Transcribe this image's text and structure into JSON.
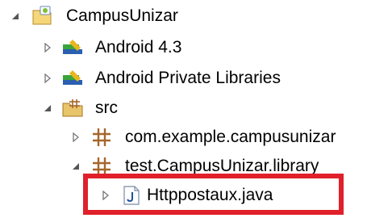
{
  "tree": {
    "project": {
      "label": "CampusUnizar",
      "icon": "android-project-icon",
      "expanded": true
    },
    "libs": [
      {
        "label": "Android 4.3",
        "icon": "library-icon",
        "expanded": false
      },
      {
        "label": "Android Private Libraries",
        "icon": "library-icon",
        "expanded": false
      }
    ],
    "src": {
      "label": "src",
      "icon": "source-folder-icon",
      "expanded": true
    },
    "packages": [
      {
        "label": "com.example.campusunizar",
        "icon": "package-icon",
        "expanded": false
      },
      {
        "label": "test.CampusUnizar.library",
        "icon": "package-icon",
        "expanded": true
      }
    ],
    "file": {
      "label": "Httppostaux.java",
      "icon": "java-file-icon",
      "expanded": false,
      "highlighted": true
    }
  },
  "colors": {
    "highlight": "#e0202a",
    "library_green": "#3aa53a",
    "library_blue": "#2b5fb0",
    "library_yellow": "#e8b620",
    "package_brown": "#a5672a",
    "folder_yellow": "#e8c46a"
  }
}
